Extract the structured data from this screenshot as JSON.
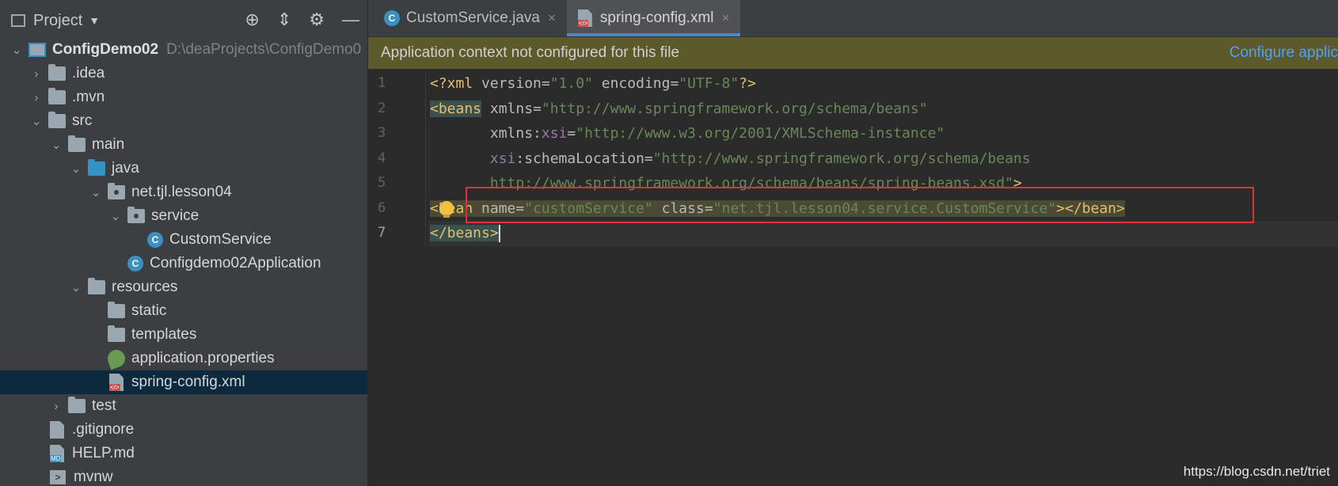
{
  "sidebar": {
    "title": "Project",
    "tree": [
      {
        "label": "ConfigDemo02",
        "path": "D:\\deaProjects\\ConfigDemo0",
        "depth": 0,
        "arrow": "⌄",
        "icon": "module",
        "bold": true
      },
      {
        "label": ".idea",
        "depth": 1,
        "arrow": "›",
        "icon": "folder"
      },
      {
        "label": ".mvn",
        "depth": 1,
        "arrow": "›",
        "icon": "folder"
      },
      {
        "label": "src",
        "depth": 1,
        "arrow": "⌄",
        "icon": "folder"
      },
      {
        "label": "main",
        "depth": 2,
        "arrow": "⌄",
        "icon": "folder"
      },
      {
        "label": "java",
        "depth": 3,
        "arrow": "⌄",
        "icon": "folder-blue"
      },
      {
        "label": "net.tjl.lesson04",
        "depth": 4,
        "arrow": "⌄",
        "icon": "package"
      },
      {
        "label": "service",
        "depth": 5,
        "arrow": "⌄",
        "icon": "package"
      },
      {
        "label": "CustomService",
        "depth": 6,
        "arrow": "",
        "icon": "class"
      },
      {
        "label": "Configdemo02Application",
        "depth": 5,
        "arrow": "",
        "icon": "class"
      },
      {
        "label": "resources",
        "depth": 3,
        "arrow": "⌄",
        "icon": "folder"
      },
      {
        "label": "static",
        "depth": 4,
        "arrow": "",
        "icon": "folder"
      },
      {
        "label": "templates",
        "depth": 4,
        "arrow": "",
        "icon": "folder"
      },
      {
        "label": "application.properties",
        "depth": 4,
        "arrow": "",
        "icon": "spring"
      },
      {
        "label": "spring-config.xml",
        "depth": 4,
        "arrow": "",
        "icon": "xml",
        "selected": true
      },
      {
        "label": "test",
        "depth": 2,
        "arrow": "›",
        "icon": "folder"
      },
      {
        "label": ".gitignore",
        "depth": 1,
        "arrow": "",
        "icon": "file"
      },
      {
        "label": "HELP.md",
        "depth": 1,
        "arrow": "",
        "icon": "md"
      },
      {
        "label": "mvnw",
        "depth": 1,
        "arrow": "",
        "icon": "terminal"
      }
    ]
  },
  "tabs": [
    {
      "label": "CustomService.java",
      "close": "×"
    },
    {
      "label": "spring-config.xml",
      "close": "×"
    }
  ],
  "banner": {
    "message": "Application context not configured for this file",
    "link": "Configure applic"
  },
  "line_numbers": [
    "1",
    "2",
    "3",
    "4",
    "5",
    "6",
    "7"
  ],
  "code": {
    "l1_a": "<?xml ",
    "l1_b": "version",
    "l1_c": "=",
    "l1_d": "\"1.0\"",
    "l1_e": " encoding",
    "l1_f": "=",
    "l1_g": "\"UTF-8\"",
    "l1_h": "?>",
    "l2_a": "<beans",
    "l2_b": " xmlns",
    "l2_c": "=",
    "l2_d": "\"http://www.springframework.org/schema/beans\"",
    "l3_a": "       xmlns:",
    "l3_b": "xsi",
    "l3_c": "=",
    "l3_d": "\"http://www.w3.org/2001/XMLSchema-instance\"",
    "l4_a": "       ",
    "l4_b": "xsi",
    "l4_c": ":schemaLocation",
    "l4_d": "=",
    "l4_e": "\"http://www.springframework.org/schema/beans",
    "l5_a": "       http://www.springframework.org/schema/beans/spring-beans.xsd\"",
    "l5_b": ">",
    "l6_a": "<bean",
    "l6_b": " name",
    "l6_c": "=",
    "l6_d": "\"customService\"",
    "l6_e": " class",
    "l6_f": "=",
    "l6_g": "\"net.tjl.lesson04.service.CustomService\"",
    "l6_h": "></bean>",
    "l7_a": "</beans>"
  },
  "watermark": "https://blog.csdn.net/triet"
}
